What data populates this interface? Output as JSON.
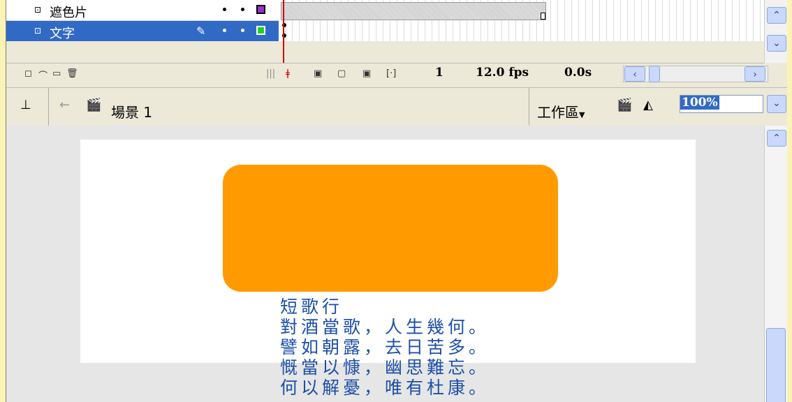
{
  "timeline": {
    "layers": [
      {
        "name": "遮色片",
        "type": "mask",
        "dots": [
          "•",
          "•"
        ],
        "color": "#9b30c9"
      },
      {
        "name": "文字",
        "type": "masked",
        "dots": [
          "•",
          "•"
        ],
        "color": "#22d022",
        "selected": true
      }
    ],
    "frame_number": "1",
    "fps": "12.0 fps",
    "elapsed": "0.0s"
  },
  "editbar": {
    "scene": "場景 1",
    "workspace_label": "工作區",
    "zoom": "100%"
  },
  "stage": {
    "shape_color": "#ff9b00",
    "poem_lines": [
      "短歌行",
      "對酒當歌，人生幾何。",
      "譬如朝露，去日苦多。",
      "慨當以慷，幽思難忘。",
      "何以解憂，唯有杜康。"
    ]
  },
  "colors": {
    "selected_row": "#316ac5",
    "background_outer": "#fbf3b6"
  }
}
